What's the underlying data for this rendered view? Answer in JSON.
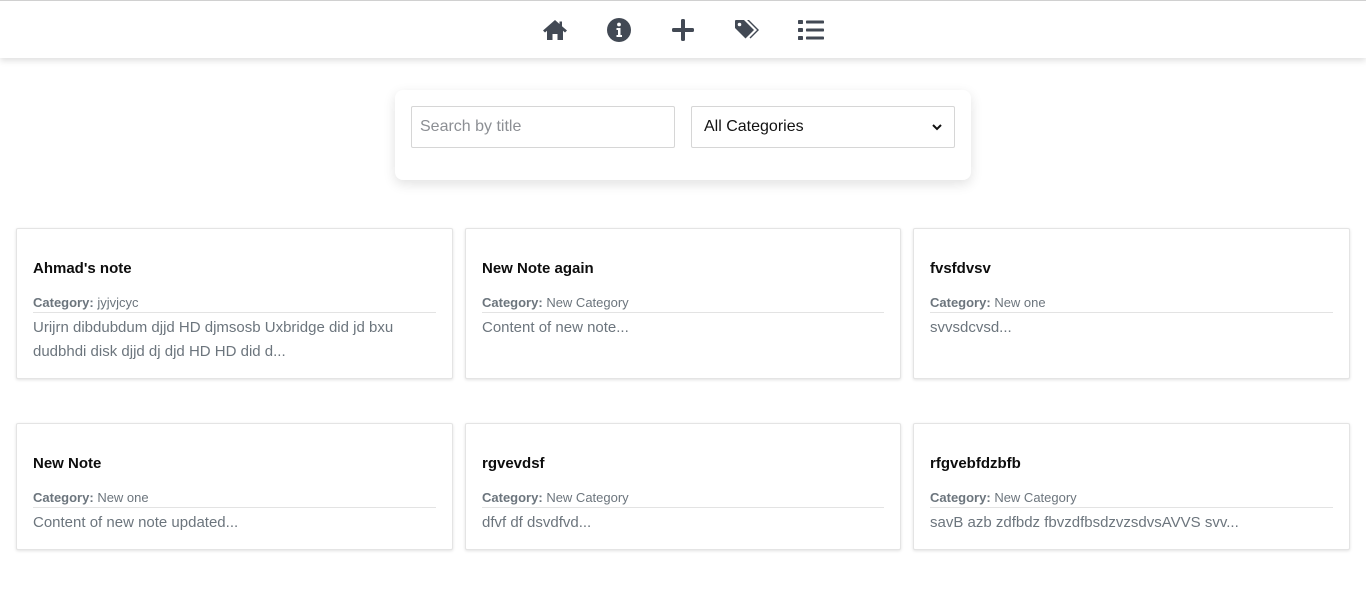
{
  "nav": {
    "icons": [
      "home-icon",
      "info-icon",
      "plus-icon",
      "tags-icon",
      "list-icon"
    ]
  },
  "filters": {
    "search_placeholder": "Search by title",
    "category_selected": "All Categories"
  },
  "notes": [
    {
      "title": "Ahmad's note",
      "category_label": "Category:",
      "category": "jyjvjcyc",
      "content": "Urijrn dibdubdum djjd HD djmsosb Uxbridge did jd bxu dudbhdi disk djjd dj djd HD HD did d..."
    },
    {
      "title": "New Note again",
      "category_label": "Category:",
      "category": "New Category",
      "content": "Content of new note..."
    },
    {
      "title": "fvsfdvsv",
      "category_label": "Category:",
      "category": "New one",
      "content": "svvsdcvsd..."
    },
    {
      "title": "New Note",
      "category_label": "Category:",
      "category": "New one",
      "content": "Content of new note updated..."
    },
    {
      "title": "rgvevdsf",
      "category_label": "Category:",
      "category": "New Category",
      "content": "dfvf df dsvdfvd..."
    },
    {
      "title": "rfgvebfdzbfb",
      "category_label": "Category:",
      "category": "New Category",
      "content": "savB azb zdfbdz fbvzdfbsdzvzsdvsAVVS svv..."
    }
  ],
  "colors": {
    "icon": "#424954",
    "muted_text": "#6c757d"
  }
}
